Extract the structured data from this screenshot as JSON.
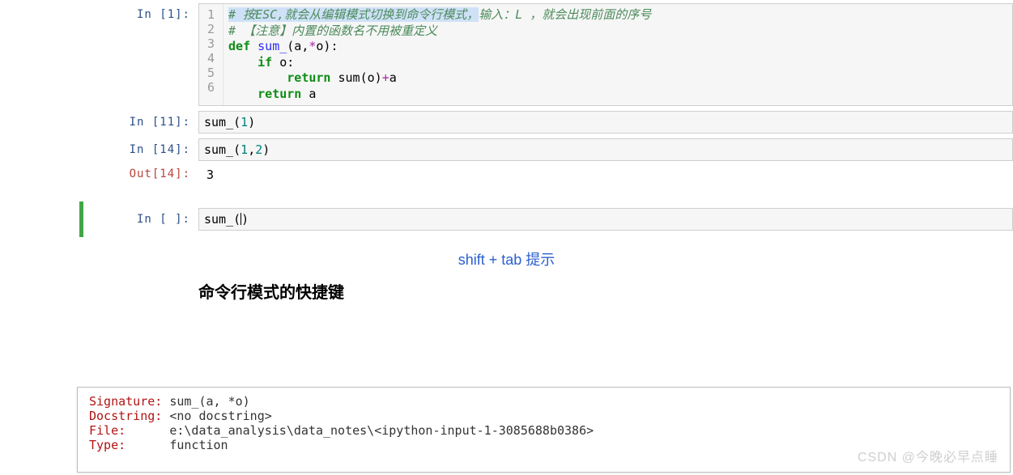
{
  "cells": {
    "c1": {
      "prompt": "In  [1]:",
      "src": {
        "l1_sel": "# 按ESC,就会从编辑模式切换到命令行模式，",
        "l1_rest": "输入：L ，就会出现前面的序号",
        "l2": "# 【注意】内置的函数名不用被重定义",
        "l3": {
          "kw1": "def",
          "fn": " sum_",
          "paren": "(a,",
          "op": "*",
          "rest": "o):"
        },
        "l4": {
          "kw": "if",
          "rest": " o:"
        },
        "l5": {
          "kw": "return",
          "fn": " sum",
          "op": "+",
          "paren_o": "(o)",
          "rest": "a"
        },
        "l6": {
          "kw": "return",
          "rest": " a"
        }
      },
      "ln": [
        "1",
        "2",
        "3",
        "4",
        "5",
        "6"
      ]
    },
    "c2": {
      "prompt": "In  [11]:",
      "src": {
        "fn": "sum_",
        "num": "1"
      }
    },
    "c3": {
      "prompt": "In  [14]:",
      "src": {
        "fn": "sum_",
        "n1": "1",
        "n2": "2"
      }
    },
    "c3out": {
      "prompt": "Out[14]:",
      "val": "3"
    },
    "c4": {
      "prompt": "In  [ ]:",
      "src": {
        "fn": "sum_"
      }
    }
  },
  "caption": "shift + tab 提示",
  "heading": "命令行模式的快捷键",
  "tooltip": {
    "sig_label": "Signature: ",
    "sig_val": "sum_(a, *o)",
    "doc_label": "Docstring: ",
    "doc_val": "<no docstring>",
    "file_label": "File:      ",
    "file_val": "e:\\data_analysis\\data_notes\\<ipython-input-1-3085688b0386>",
    "type_label": "Type:      ",
    "type_val": "function"
  },
  "watermark": "CSDN @今晚必早点睡"
}
